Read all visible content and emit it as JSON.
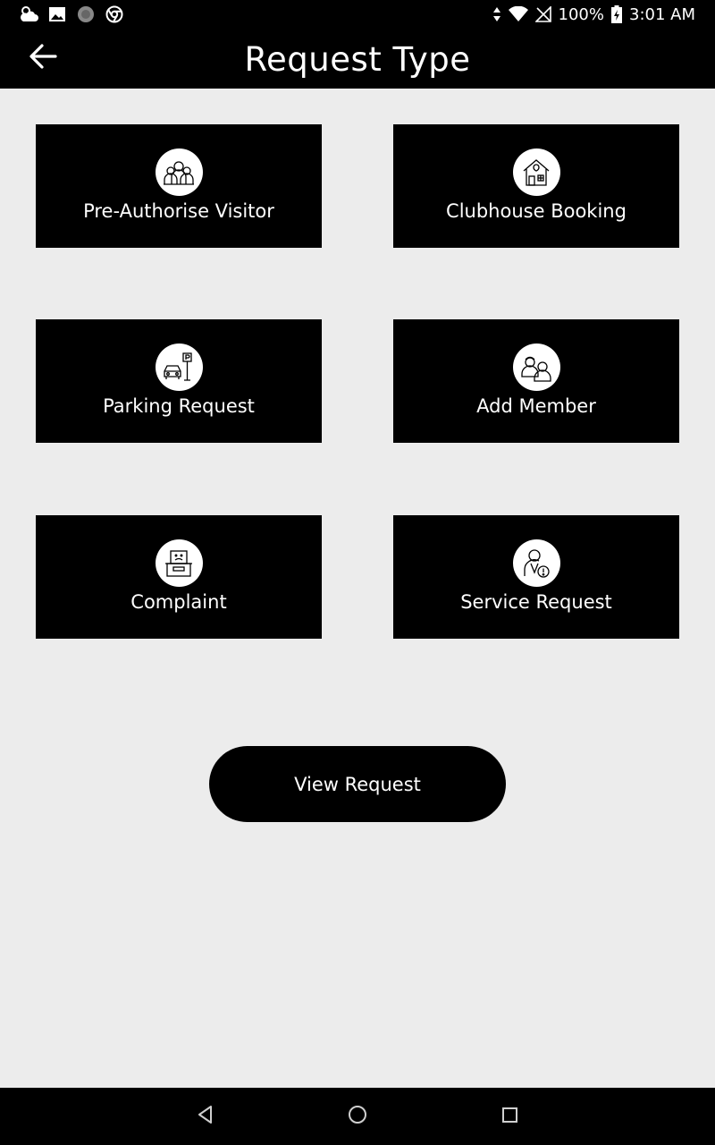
{
  "status_bar": {
    "battery": "100%",
    "time": "3:01 AM",
    "icons": [
      "weather-icon",
      "image-icon",
      "record-icon",
      "chrome-icon",
      "data-arrows-icon",
      "wifi-icon",
      "no-signal-icon",
      "battery-charging-icon"
    ]
  },
  "header": {
    "title": "Request Type",
    "back_icon": "arrow-left-icon"
  },
  "tiles": [
    {
      "label": "Pre-Authorise Visitor",
      "icon": "visitors-icon"
    },
    {
      "label": "Clubhouse Booking",
      "icon": "clubhouse-icon"
    },
    {
      "label": "Parking Request",
      "icon": "parking-car-icon"
    },
    {
      "label": "Add Member",
      "icon": "members-icon"
    },
    {
      "label": "Complaint",
      "icon": "complaint-box-icon"
    },
    {
      "label": "Service Request",
      "icon": "service-person-icon"
    }
  ],
  "view_request": {
    "label": "View Request"
  },
  "nav_bar": {
    "icons": [
      "back-triangle-icon",
      "home-circle-icon",
      "recents-square-icon"
    ]
  },
  "colors": {
    "background": "#ececec",
    "bars": "#000000",
    "text_on_dark": "#ffffff"
  }
}
